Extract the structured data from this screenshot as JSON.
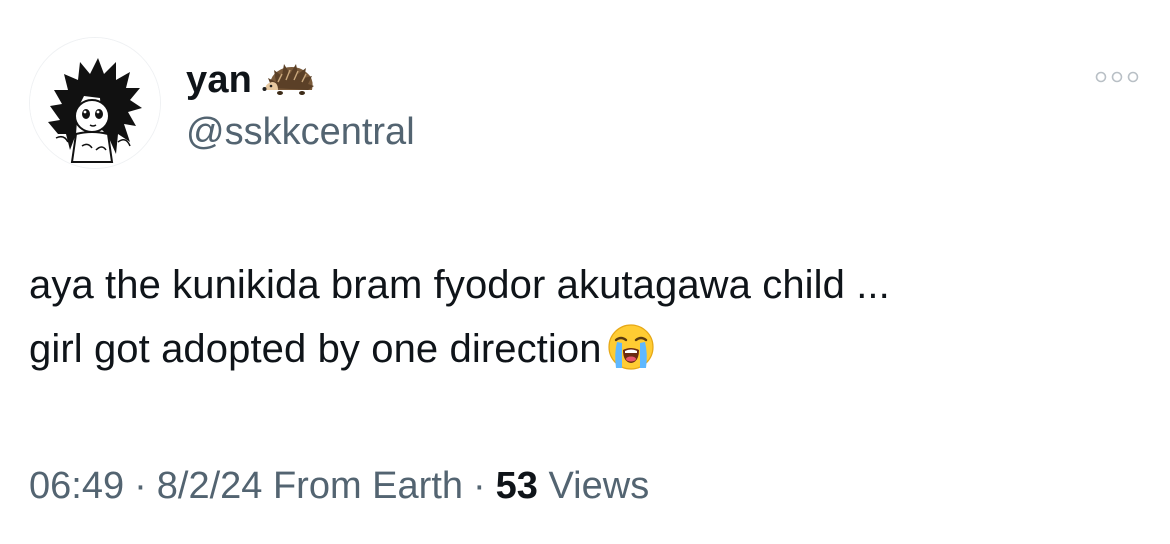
{
  "author": {
    "display_name": "yan",
    "name_emoji_icon": "hedgehog-icon",
    "handle": "@sskkcentral",
    "avatar_icon": "anime-character-avatar"
  },
  "tweet": {
    "line1": "aya the kunikida bram fyodor akutagawa child ...",
    "line2": "girl got adopted by one direction",
    "trailing_emoji_icon": "loudly-crying-face-icon"
  },
  "meta": {
    "time": "06:49",
    "separator": "·",
    "date": "8/2/24",
    "source": "From Earth",
    "views_count": "53",
    "views_label": "Views"
  },
  "colors": {
    "text_primary": "#0f1419",
    "text_secondary": "#536471",
    "background": "#ffffff"
  }
}
